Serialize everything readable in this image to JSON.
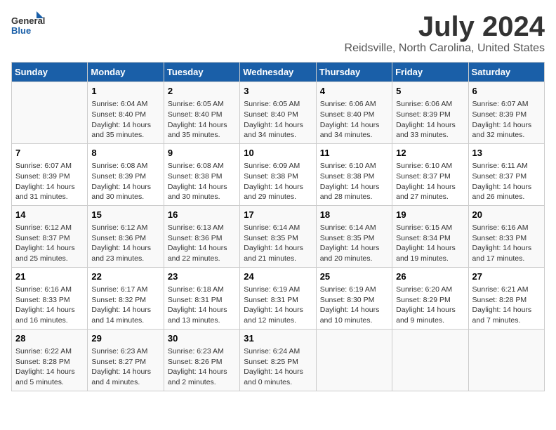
{
  "header": {
    "logo_general": "General",
    "logo_blue": "Blue",
    "title": "July 2024",
    "subtitle": "Reidsville, North Carolina, United States"
  },
  "calendar": {
    "weekdays": [
      "Sunday",
      "Monday",
      "Tuesday",
      "Wednesday",
      "Thursday",
      "Friday",
      "Saturday"
    ],
    "weeks": [
      [
        {
          "day": "",
          "content": ""
        },
        {
          "day": "1",
          "content": "Sunrise: 6:04 AM\nSunset: 8:40 PM\nDaylight: 14 hours\nand 35 minutes."
        },
        {
          "day": "2",
          "content": "Sunrise: 6:05 AM\nSunset: 8:40 PM\nDaylight: 14 hours\nand 35 minutes."
        },
        {
          "day": "3",
          "content": "Sunrise: 6:05 AM\nSunset: 8:40 PM\nDaylight: 14 hours\nand 34 minutes."
        },
        {
          "day": "4",
          "content": "Sunrise: 6:06 AM\nSunset: 8:40 PM\nDaylight: 14 hours\nand 34 minutes."
        },
        {
          "day": "5",
          "content": "Sunrise: 6:06 AM\nSunset: 8:39 PM\nDaylight: 14 hours\nand 33 minutes."
        },
        {
          "day": "6",
          "content": "Sunrise: 6:07 AM\nSunset: 8:39 PM\nDaylight: 14 hours\nand 32 minutes."
        }
      ],
      [
        {
          "day": "7",
          "content": "Sunrise: 6:07 AM\nSunset: 8:39 PM\nDaylight: 14 hours\nand 31 minutes."
        },
        {
          "day": "8",
          "content": "Sunrise: 6:08 AM\nSunset: 8:39 PM\nDaylight: 14 hours\nand 30 minutes."
        },
        {
          "day": "9",
          "content": "Sunrise: 6:08 AM\nSunset: 8:38 PM\nDaylight: 14 hours\nand 30 minutes."
        },
        {
          "day": "10",
          "content": "Sunrise: 6:09 AM\nSunset: 8:38 PM\nDaylight: 14 hours\nand 29 minutes."
        },
        {
          "day": "11",
          "content": "Sunrise: 6:10 AM\nSunset: 8:38 PM\nDaylight: 14 hours\nand 28 minutes."
        },
        {
          "day": "12",
          "content": "Sunrise: 6:10 AM\nSunset: 8:37 PM\nDaylight: 14 hours\nand 27 minutes."
        },
        {
          "day": "13",
          "content": "Sunrise: 6:11 AM\nSunset: 8:37 PM\nDaylight: 14 hours\nand 26 minutes."
        }
      ],
      [
        {
          "day": "14",
          "content": "Sunrise: 6:12 AM\nSunset: 8:37 PM\nDaylight: 14 hours\nand 25 minutes."
        },
        {
          "day": "15",
          "content": "Sunrise: 6:12 AM\nSunset: 8:36 PM\nDaylight: 14 hours\nand 23 minutes."
        },
        {
          "day": "16",
          "content": "Sunrise: 6:13 AM\nSunset: 8:36 PM\nDaylight: 14 hours\nand 22 minutes."
        },
        {
          "day": "17",
          "content": "Sunrise: 6:14 AM\nSunset: 8:35 PM\nDaylight: 14 hours\nand 21 minutes."
        },
        {
          "day": "18",
          "content": "Sunrise: 6:14 AM\nSunset: 8:35 PM\nDaylight: 14 hours\nand 20 minutes."
        },
        {
          "day": "19",
          "content": "Sunrise: 6:15 AM\nSunset: 8:34 PM\nDaylight: 14 hours\nand 19 minutes."
        },
        {
          "day": "20",
          "content": "Sunrise: 6:16 AM\nSunset: 8:33 PM\nDaylight: 14 hours\nand 17 minutes."
        }
      ],
      [
        {
          "day": "21",
          "content": "Sunrise: 6:16 AM\nSunset: 8:33 PM\nDaylight: 14 hours\nand 16 minutes."
        },
        {
          "day": "22",
          "content": "Sunrise: 6:17 AM\nSunset: 8:32 PM\nDaylight: 14 hours\nand 14 minutes."
        },
        {
          "day": "23",
          "content": "Sunrise: 6:18 AM\nSunset: 8:31 PM\nDaylight: 14 hours\nand 13 minutes."
        },
        {
          "day": "24",
          "content": "Sunrise: 6:19 AM\nSunset: 8:31 PM\nDaylight: 14 hours\nand 12 minutes."
        },
        {
          "day": "25",
          "content": "Sunrise: 6:19 AM\nSunset: 8:30 PM\nDaylight: 14 hours\nand 10 minutes."
        },
        {
          "day": "26",
          "content": "Sunrise: 6:20 AM\nSunset: 8:29 PM\nDaylight: 14 hours\nand 9 minutes."
        },
        {
          "day": "27",
          "content": "Sunrise: 6:21 AM\nSunset: 8:28 PM\nDaylight: 14 hours\nand 7 minutes."
        }
      ],
      [
        {
          "day": "28",
          "content": "Sunrise: 6:22 AM\nSunset: 8:28 PM\nDaylight: 14 hours\nand 5 minutes."
        },
        {
          "day": "29",
          "content": "Sunrise: 6:23 AM\nSunset: 8:27 PM\nDaylight: 14 hours\nand 4 minutes."
        },
        {
          "day": "30",
          "content": "Sunrise: 6:23 AM\nSunset: 8:26 PM\nDaylight: 14 hours\nand 2 minutes."
        },
        {
          "day": "31",
          "content": "Sunrise: 6:24 AM\nSunset: 8:25 PM\nDaylight: 14 hours\nand 0 minutes."
        },
        {
          "day": "",
          "content": ""
        },
        {
          "day": "",
          "content": ""
        },
        {
          "day": "",
          "content": ""
        }
      ]
    ]
  }
}
